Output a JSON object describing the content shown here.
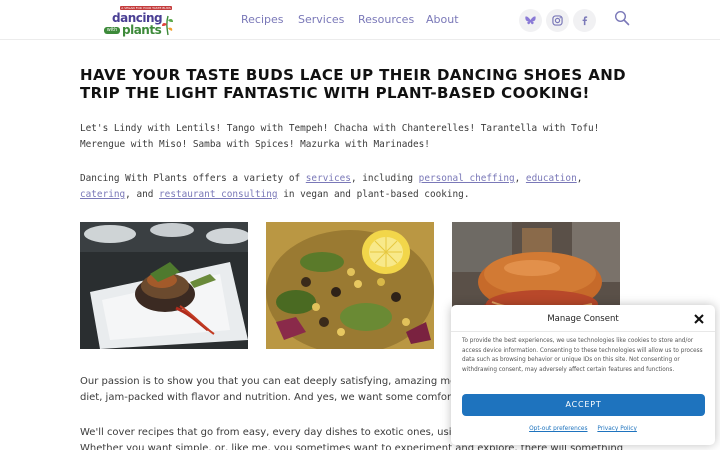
{
  "header": {
    "logo": {
      "tagline": "A VEGAN FOR YOUR TASTE BUDS",
      "word1": "dancing",
      "word_with": "with",
      "word2": "plants"
    },
    "nav": [
      "Recipes",
      "Services",
      "Resources",
      "About"
    ],
    "social": [
      {
        "name": "bluesky",
        "icon": "butterfly-icon",
        "color": "#8a7ad6"
      },
      {
        "name": "instagram",
        "icon": "instagram-icon",
        "color": "#7a78b8"
      },
      {
        "name": "facebook",
        "icon": "facebook-icon",
        "color": "#7a78b8"
      }
    ],
    "search_icon": "search-icon"
  },
  "main": {
    "heading": "HAVE YOUR TASTE BUDS LACE UP THEIR DANCING SHOES AND TRIP THE LIGHT FANTASTIC WITH PLANT-BASED COOKING!",
    "intro": "Let's Lindy with Lentils! Tango with Tempeh! Chacha with Chanterelles! Tarantella with Tofu! Merengue with Miso! Samba with Spices! Mazurka with Marinades!",
    "services_sentence": {
      "prefix": "Dancing With Plants offers a variety of ",
      "link_services": "services",
      "text_including": ", including ",
      "link_chef": "personal cheffing",
      "comma1": ", ",
      "link_education": "education",
      "comma2": ", ",
      "link_catering": "catering",
      "text_and": ", and ",
      "link_consulting": "restaurant consulting",
      "suffix": " in vegan and plant-based cooking."
    },
    "passion_line1": "Our passion is to show you that you can eat deeply satisfying, amazing meals",
    "passion_line2": "diet, jam-packed with flavor and nutrition. And yes, we want some comfort foo",
    "cover_line1": "We'll cover recipes that go from easy, every day dishes to exotic ones, using t",
    "cover_line2": "Whether you want simple, or, like me, you sometimes want to experiment and explore, there will something for"
  },
  "colors": {
    "accent": "#7a78b8",
    "link": "#7a78b8",
    "accept_button": "#1e73be",
    "logo_purple": "#4a3f94",
    "logo_green": "#3d8a3a"
  },
  "consent": {
    "title": "Manage Consent",
    "body": "To provide the best experiences, we use technologies like cookies to store and/or access device information. Consenting to these technologies will allow us to process data such as browsing behavior or unique IDs on this site. Not consenting or withdrawing consent, may adversely affect certain features and functions.",
    "accept_label": "ACCEPT",
    "opt_out_label": "Opt-out preferences",
    "privacy_label": "Privacy Policy"
  }
}
